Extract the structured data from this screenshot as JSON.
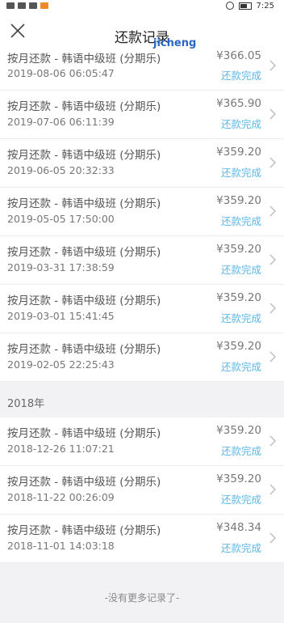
{
  "status_bar": {
    "time": "7:25"
  },
  "header": {
    "title": "还款记录",
    "watermark": "jicheng"
  },
  "records_2019": [
    {
      "title": "按月还款 - 韩语中级班 (分期乐)",
      "date": "2019-08-06 06:05:47",
      "amount": "¥366.05",
      "status": "还款完成"
    },
    {
      "title": "按月还款 - 韩语中级班 (分期乐)",
      "date": "2019-07-06 06:11:39",
      "amount": "¥365.90",
      "status": "还款完成"
    },
    {
      "title": "按月还款 - 韩语中级班 (分期乐)",
      "date": "2019-06-05 20:32:33",
      "amount": "¥359.20",
      "status": "还款完成"
    },
    {
      "title": "按月还款 - 韩语中级班 (分期乐)",
      "date": "2019-05-05 17:50:00",
      "amount": "¥359.20",
      "status": "还款完成"
    },
    {
      "title": "按月还款 - 韩语中级班 (分期乐)",
      "date": "2019-03-31 17:38:59",
      "amount": "¥359.20",
      "status": "还款完成"
    },
    {
      "title": "按月还款 - 韩语中级班 (分期乐)",
      "date": "2019-03-01 15:41:45",
      "amount": "¥359.20",
      "status": "还款完成"
    },
    {
      "title": "按月还款 - 韩语中级班 (分期乐)",
      "date": "2019-02-05 22:25:43",
      "amount": "¥359.20",
      "status": "还款完成"
    }
  ],
  "section_2018": {
    "label": "2018年"
  },
  "records_2018": [
    {
      "title": "按月还款 - 韩语中级班 (分期乐)",
      "date": "2018-12-26 11:07:21",
      "amount": "¥359.20",
      "status": "还款完成"
    },
    {
      "title": "按月还款 - 韩语中级班 (分期乐)",
      "date": "2018-11-22 00:26:09",
      "amount": "¥359.20",
      "status": "还款完成"
    },
    {
      "title": "按月还款 - 韩语中级班 (分期乐)",
      "date": "2018-11-01 14:03:18",
      "amount": "¥348.34",
      "status": "还款完成"
    }
  ],
  "footer": {
    "text": "-没有更多记录了-"
  },
  "colors": {
    "status_blue": "#5bb7e5",
    "background": "#f2f2f4"
  },
  "icons": {
    "close": "close-icon",
    "chevron": "chevron-right-icon"
  }
}
